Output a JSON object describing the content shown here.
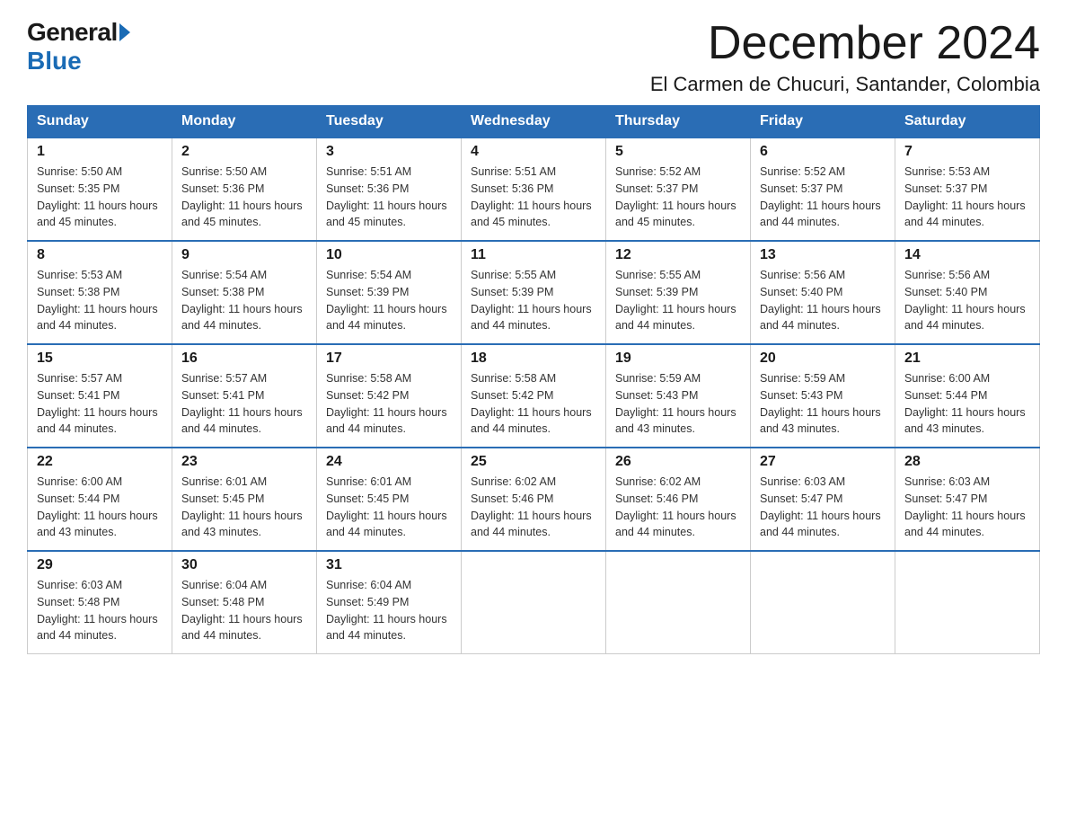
{
  "logo": {
    "general": "General",
    "blue": "Blue",
    "arrow": "▶"
  },
  "title": "December 2024",
  "subtitle": "El Carmen de Chucuri, Santander, Colombia",
  "days_of_week": [
    "Sunday",
    "Monday",
    "Tuesday",
    "Wednesday",
    "Thursday",
    "Friday",
    "Saturday"
  ],
  "weeks": [
    [
      {
        "day": "1",
        "sunrise": "5:50 AM",
        "sunset": "5:35 PM",
        "daylight": "11 hours and 45 minutes."
      },
      {
        "day": "2",
        "sunrise": "5:50 AM",
        "sunset": "5:36 PM",
        "daylight": "11 hours and 45 minutes."
      },
      {
        "day": "3",
        "sunrise": "5:51 AM",
        "sunset": "5:36 PM",
        "daylight": "11 hours and 45 minutes."
      },
      {
        "day": "4",
        "sunrise": "5:51 AM",
        "sunset": "5:36 PM",
        "daylight": "11 hours and 45 minutes."
      },
      {
        "day": "5",
        "sunrise": "5:52 AM",
        "sunset": "5:37 PM",
        "daylight": "11 hours and 45 minutes."
      },
      {
        "day": "6",
        "sunrise": "5:52 AM",
        "sunset": "5:37 PM",
        "daylight": "11 hours and 44 minutes."
      },
      {
        "day": "7",
        "sunrise": "5:53 AM",
        "sunset": "5:37 PM",
        "daylight": "11 hours and 44 minutes."
      }
    ],
    [
      {
        "day": "8",
        "sunrise": "5:53 AM",
        "sunset": "5:38 PM",
        "daylight": "11 hours and 44 minutes."
      },
      {
        "day": "9",
        "sunrise": "5:54 AM",
        "sunset": "5:38 PM",
        "daylight": "11 hours and 44 minutes."
      },
      {
        "day": "10",
        "sunrise": "5:54 AM",
        "sunset": "5:39 PM",
        "daylight": "11 hours and 44 minutes."
      },
      {
        "day": "11",
        "sunrise": "5:55 AM",
        "sunset": "5:39 PM",
        "daylight": "11 hours and 44 minutes."
      },
      {
        "day": "12",
        "sunrise": "5:55 AM",
        "sunset": "5:39 PM",
        "daylight": "11 hours and 44 minutes."
      },
      {
        "day": "13",
        "sunrise": "5:56 AM",
        "sunset": "5:40 PM",
        "daylight": "11 hours and 44 minutes."
      },
      {
        "day": "14",
        "sunrise": "5:56 AM",
        "sunset": "5:40 PM",
        "daylight": "11 hours and 44 minutes."
      }
    ],
    [
      {
        "day": "15",
        "sunrise": "5:57 AM",
        "sunset": "5:41 PM",
        "daylight": "11 hours and 44 minutes."
      },
      {
        "day": "16",
        "sunrise": "5:57 AM",
        "sunset": "5:41 PM",
        "daylight": "11 hours and 44 minutes."
      },
      {
        "day": "17",
        "sunrise": "5:58 AM",
        "sunset": "5:42 PM",
        "daylight": "11 hours and 44 minutes."
      },
      {
        "day": "18",
        "sunrise": "5:58 AM",
        "sunset": "5:42 PM",
        "daylight": "11 hours and 44 minutes."
      },
      {
        "day": "19",
        "sunrise": "5:59 AM",
        "sunset": "5:43 PM",
        "daylight": "11 hours and 43 minutes."
      },
      {
        "day": "20",
        "sunrise": "5:59 AM",
        "sunset": "5:43 PM",
        "daylight": "11 hours and 43 minutes."
      },
      {
        "day": "21",
        "sunrise": "6:00 AM",
        "sunset": "5:44 PM",
        "daylight": "11 hours and 43 minutes."
      }
    ],
    [
      {
        "day": "22",
        "sunrise": "6:00 AM",
        "sunset": "5:44 PM",
        "daylight": "11 hours and 43 minutes."
      },
      {
        "day": "23",
        "sunrise": "6:01 AM",
        "sunset": "5:45 PM",
        "daylight": "11 hours and 43 minutes."
      },
      {
        "day": "24",
        "sunrise": "6:01 AM",
        "sunset": "5:45 PM",
        "daylight": "11 hours and 44 minutes."
      },
      {
        "day": "25",
        "sunrise": "6:02 AM",
        "sunset": "5:46 PM",
        "daylight": "11 hours and 44 minutes."
      },
      {
        "day": "26",
        "sunrise": "6:02 AM",
        "sunset": "5:46 PM",
        "daylight": "11 hours and 44 minutes."
      },
      {
        "day": "27",
        "sunrise": "6:03 AM",
        "sunset": "5:47 PM",
        "daylight": "11 hours and 44 minutes."
      },
      {
        "day": "28",
        "sunrise": "6:03 AM",
        "sunset": "5:47 PM",
        "daylight": "11 hours and 44 minutes."
      }
    ],
    [
      {
        "day": "29",
        "sunrise": "6:03 AM",
        "sunset": "5:48 PM",
        "daylight": "11 hours and 44 minutes."
      },
      {
        "day": "30",
        "sunrise": "6:04 AM",
        "sunset": "5:48 PM",
        "daylight": "11 hours and 44 minutes."
      },
      {
        "day": "31",
        "sunrise": "6:04 AM",
        "sunset": "5:49 PM",
        "daylight": "11 hours and 44 minutes."
      },
      null,
      null,
      null,
      null
    ]
  ],
  "labels": {
    "sunrise": "Sunrise:",
    "sunset": "Sunset:",
    "daylight": "Daylight:"
  }
}
